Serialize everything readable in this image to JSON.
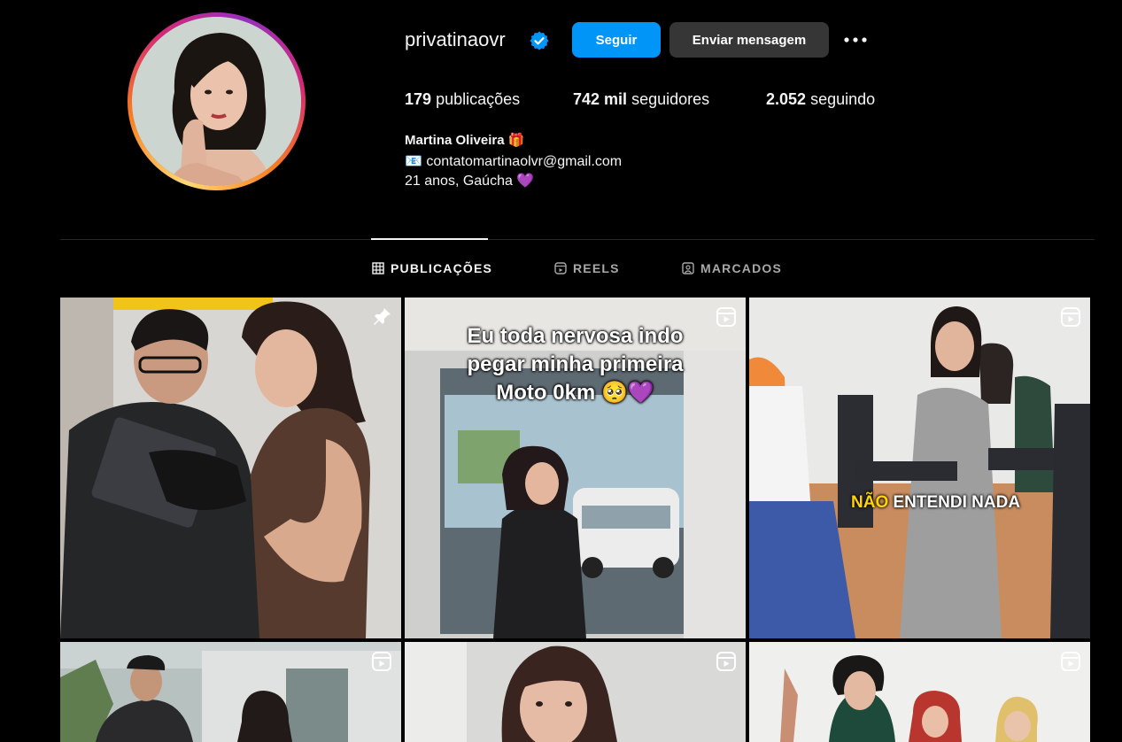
{
  "profile": {
    "username": "privatinaovr",
    "verified_icon": "verified-badge-icon",
    "follow_label": "Seguir",
    "message_label": "Enviar mensagem",
    "more_icon": "more-options-icon"
  },
  "stats": {
    "posts_count": "179",
    "posts_label": "publicações",
    "followers_count": "742 mil",
    "followers_label": "seguidores",
    "following_count": "2.052",
    "following_label": "seguindo"
  },
  "bio": {
    "name": "Martina Oliveira 🎁",
    "email_line": "📧 contatomartinaolvr@gmail.com",
    "about_line": "21 anos, Gaúcha 💜"
  },
  "tabs": [
    {
      "label": "PUBLICAÇÕES",
      "icon": "grid-icon",
      "active": true
    },
    {
      "label": "REELS",
      "icon": "reels-icon",
      "active": false
    },
    {
      "label": "MARCADOS",
      "icon": "tagged-icon",
      "active": false
    }
  ],
  "posts": [
    {
      "badge": "pin-icon",
      "caption": ""
    },
    {
      "badge": "reel-icon",
      "caption": "Eu toda nervosa indo pegar minha primeira Moto 0km 🥺💜"
    },
    {
      "badge": "reel-icon",
      "caption_highlight": "NÃO",
      "caption_rest": " ENTENDI NADA"
    },
    {
      "badge": "reel-icon",
      "caption": ""
    },
    {
      "badge": "reel-icon",
      "caption": ""
    },
    {
      "badge": "reel-icon",
      "caption": ""
    }
  ],
  "colors": {
    "background": "#000000",
    "primary_button": "#0095f6",
    "secondary_button": "#363636",
    "muted_text": "#a8a8a8"
  }
}
